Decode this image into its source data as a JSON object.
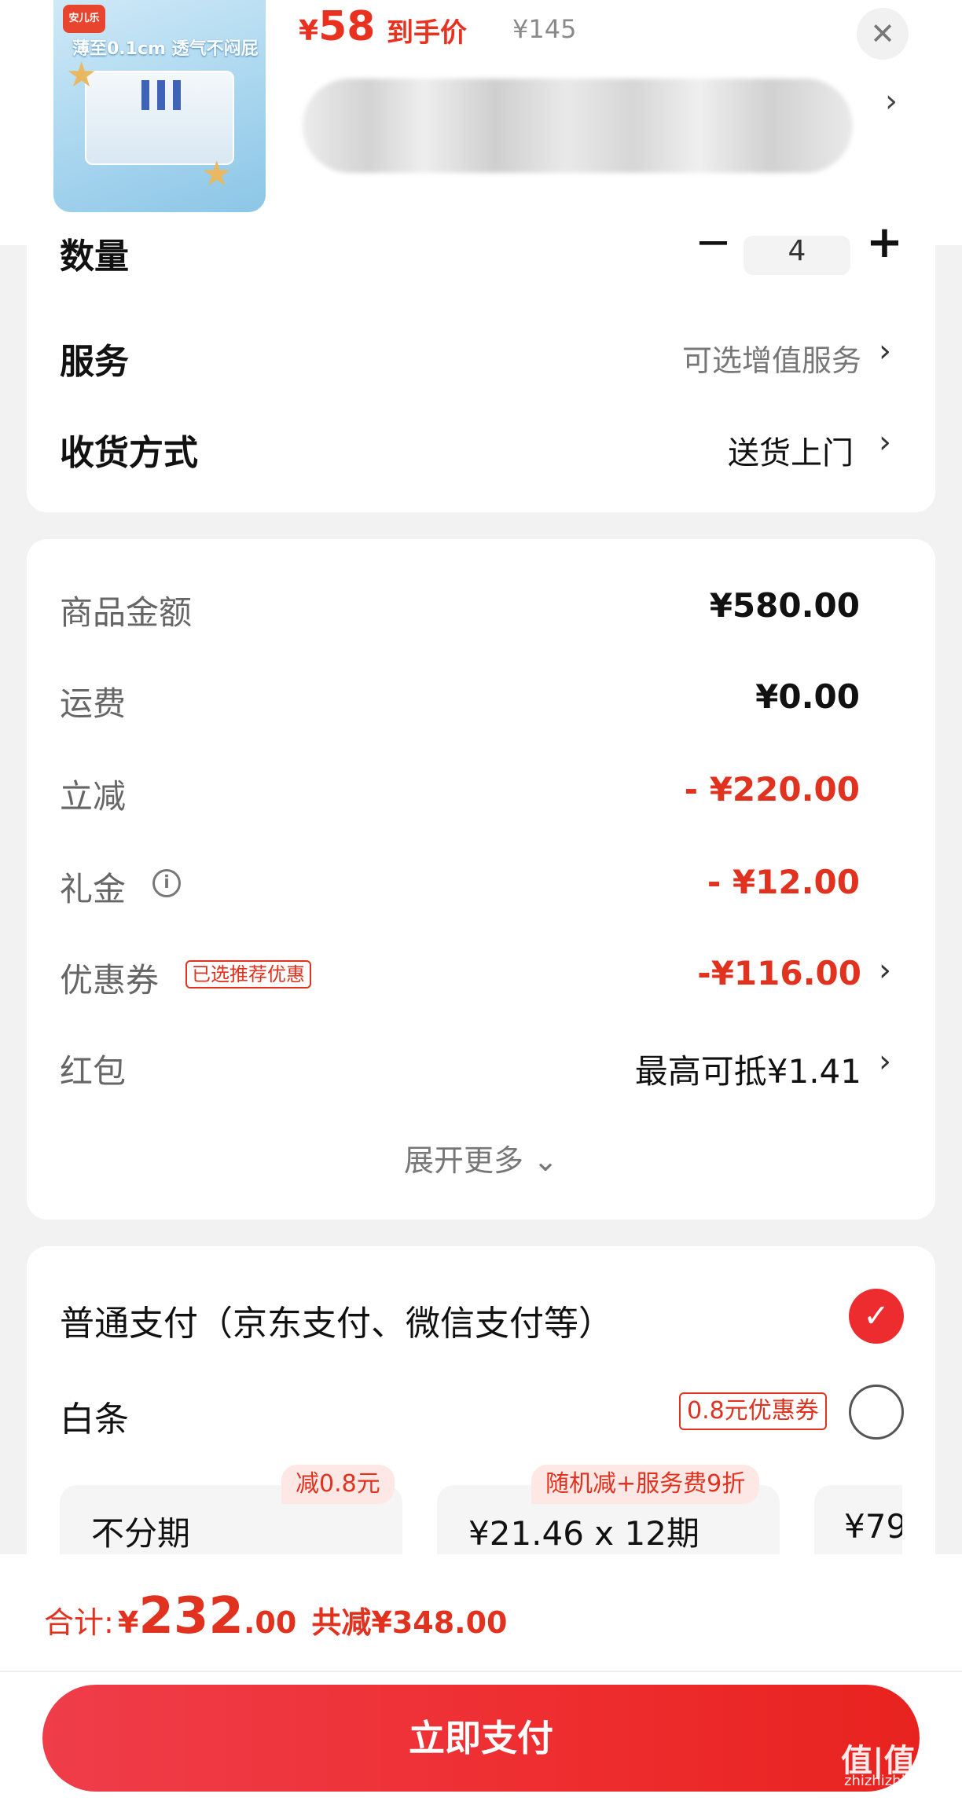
{
  "product": {
    "thumb_brand": "安儿乐",
    "thumb_slogan": "薄至0.1cm 透气不闷屁",
    "price_symbol": "¥",
    "price_value": "58",
    "price_tag": "到手价",
    "original_price": "¥145",
    "title_chevron": "›"
  },
  "options": {
    "quantity_label": "数量",
    "quantity_value": "4",
    "minus": "−",
    "plus": "+",
    "service_label": "服务",
    "service_value": "可选增值服务",
    "delivery_label": "收货方式",
    "delivery_value": "送货上门",
    "chevron": "›"
  },
  "amounts": [
    {
      "label": "商品金额",
      "value": "¥580.00"
    },
    {
      "label": "运费",
      "value": "¥0.00"
    },
    {
      "label": "立减",
      "value": "- ¥220.00"
    },
    {
      "label": "礼金",
      "value": "- ¥12.00"
    },
    {
      "label": "优惠券",
      "badge": "已选推荐优惠",
      "value": "-¥116.00"
    },
    {
      "label": "红包",
      "value": "最高可抵¥1.41"
    }
  ],
  "expand_more": "展开更多 ⌄",
  "payment": {
    "normal_label": "普通支付（京东支付、微信支付等）",
    "normal_selected": true,
    "baitiao_label": "白条",
    "baitiao_badge": "0.8元优惠券",
    "plans": [
      {
        "tag": "减0.8元",
        "text": "不分期"
      },
      {
        "tag": "随机减+服务费9折",
        "text": "¥21.46 x 12期"
      },
      {
        "text": "¥79"
      }
    ]
  },
  "footer": {
    "total_label": "合计:",
    "total_symbol": "¥",
    "total_int": "232",
    "total_dec": ".00",
    "total_saved": "共减¥348.00",
    "pay_button": "立即支付",
    "watermark": "值|值|值",
    "watermark_sub": "zhizhizhi.com"
  },
  "colors": {
    "accent_red": "#e0321f",
    "button_red": "#ee2d2f"
  }
}
